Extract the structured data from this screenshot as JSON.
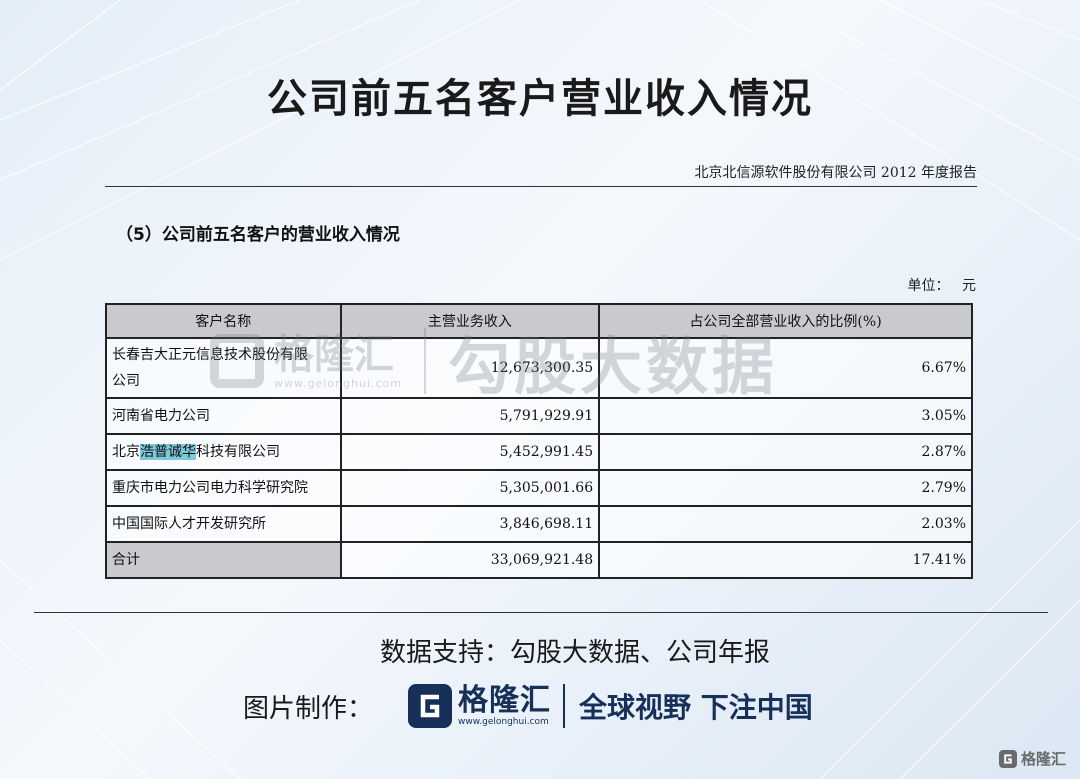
{
  "title": "公司前五名客户营业收入情况",
  "report_name": "北京北信源软件股份有限公司 2012 年度报告",
  "section_heading": "（5）公司前五名客户的营业收入情况",
  "unit": "单位： 元",
  "table": {
    "headers": [
      "客户名称",
      "主营业务收入",
      "占公司全部营业收入的比例(%)"
    ],
    "rows": [
      {
        "name_line1": "长春吉大正元信息技术股份有限",
        "name_line2": "公司",
        "revenue": "12,673,300.35",
        "ratio": "6.67%"
      },
      {
        "name": "河南省电力公司",
        "revenue": "5,791,929.91",
        "ratio": "3.05%"
      },
      {
        "name_pre": "北京",
        "name_hl": "浩普诚华",
        "name_post": "科技有限公司",
        "revenue": "5,452,991.45",
        "ratio": "2.87%"
      },
      {
        "name": "重庆市电力公司电力科学研究院",
        "revenue": "5,305,001.66",
        "ratio": "2.79%"
      },
      {
        "name": "中国国际人才开发研究所",
        "revenue": "3,846,698.11",
        "ratio": "2.03%"
      }
    ],
    "total": {
      "name": "合计",
      "revenue": "33,069,921.48",
      "ratio": "17.41%"
    }
  },
  "watermark": {
    "brand": "格隆汇",
    "url": "www.gelonghui.com",
    "slogan": "勾股大数据"
  },
  "footer": {
    "source": "数据支持：勾股大数据、公司年报",
    "credit_label": "图片制作：",
    "brand": "格隆汇",
    "brand_url": "www.gelonghui.com",
    "slogan": "全球视野 下注中国"
  },
  "corner_brand": "格隆汇",
  "colors": {
    "brand_navy": "#16305a",
    "header_gray": "#c8cacd",
    "highlight": "#7ec8dc"
  }
}
